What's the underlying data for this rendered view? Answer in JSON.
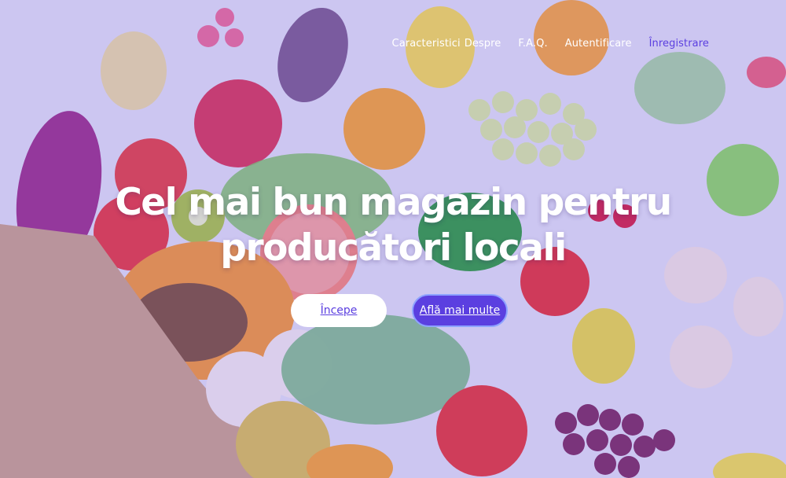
{
  "nav": {
    "items": [
      "Caracteristici",
      "Despre",
      "F.A.Q.",
      "Autentificare",
      "Înregistrare"
    ]
  },
  "hero": {
    "headline_line1": "Cel mai bun magazin pentru",
    "headline_line2": "producători locali",
    "primary_button": "Începe",
    "secondary_button": "Află mai multe"
  },
  "colors": {
    "accent": "#5b3fe0",
    "overlay": "#b9b2ee",
    "button_text_light": "#ffffff"
  },
  "background_image": "produce-flatlay-photo"
}
